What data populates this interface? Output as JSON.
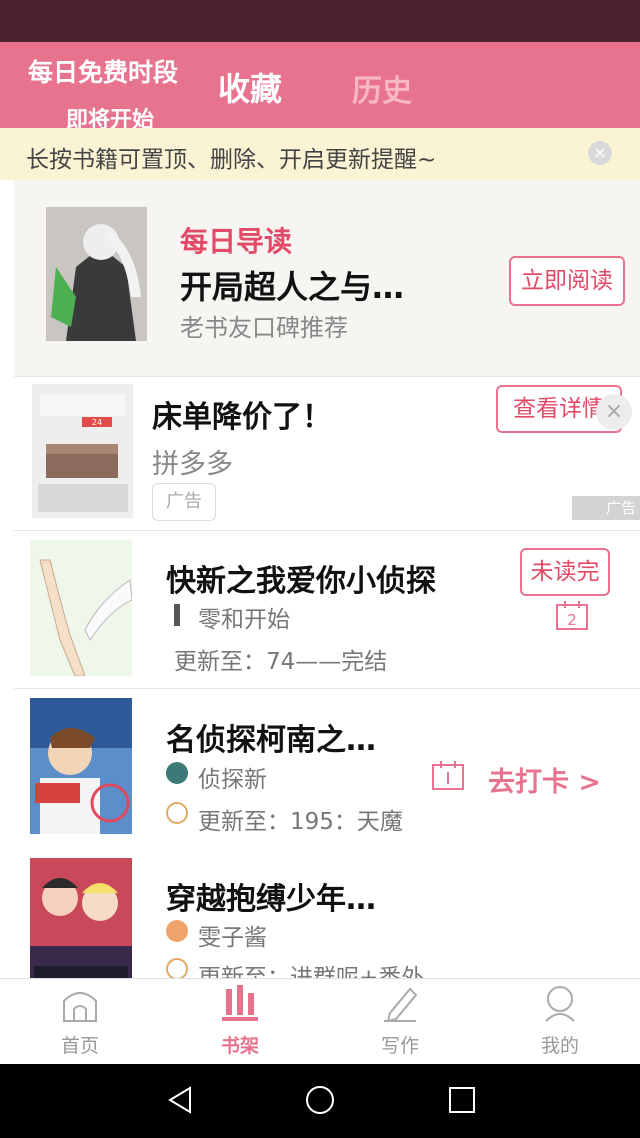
{
  "header": {
    "promo_line1": "每日免费时段",
    "promo_line2": "即将开始",
    "tabs": [
      "收藏",
      "历史"
    ]
  },
  "tip": {
    "text": "长按书籍可置顶、删除、开启更新提醒~",
    "close": "×"
  },
  "daily_guide": {
    "tag": "每日导读",
    "title": "开局超人之与…",
    "subtitle": "老书友口碑推荐",
    "button": "立即阅读"
  },
  "ad": {
    "title": "床单降价了！",
    "subtitle": "拼多多",
    "tag": "广告",
    "button": "查看详情",
    "close": "×",
    "mark": "广告",
    "banner_text": "24"
  },
  "books": [
    {
      "title": "快新之我爱你小侦探",
      "author": "零和开始",
      "update": "更新至：74——完结",
      "button": "未读完",
      "badge": "2"
    },
    {
      "title": "名侦探柯南之…",
      "author": "侦探新",
      "update": "更新至：195：天魔",
      "checkin": "去打卡 >"
    },
    {
      "title": "穿越抱缚少年…",
      "author": "雯子酱",
      "update": "更新至：进群呢+番外"
    }
  ],
  "bottom_nav": [
    {
      "label": "首页",
      "icon": "home-icon"
    },
    {
      "label": "书架",
      "icon": "bookshelf-icon",
      "active": true
    },
    {
      "label": "写作",
      "icon": "pencil-icon"
    },
    {
      "label": "我的",
      "icon": "profile-icon"
    }
  ],
  "colors": {
    "accent": "#e7738e",
    "status_bar": "#4a2230",
    "tip_bg": "#fbf4d4"
  }
}
